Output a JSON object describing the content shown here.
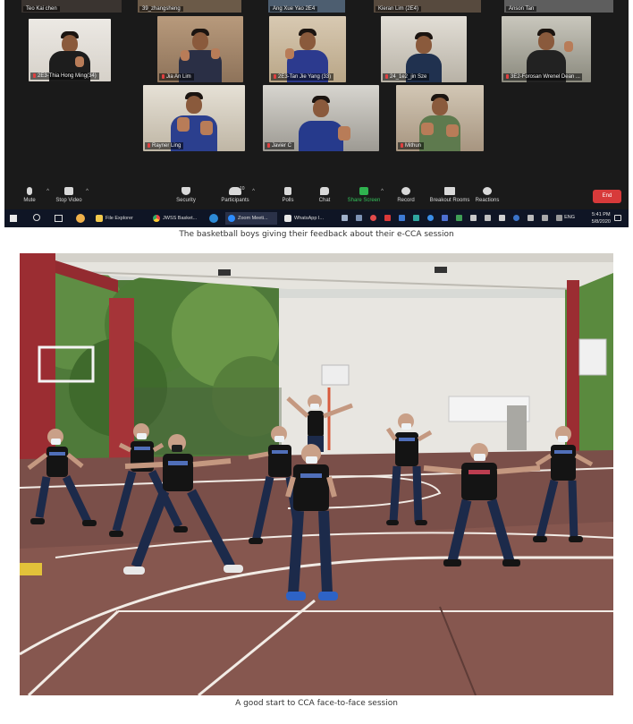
{
  "zoom": {
    "partial_names": [
      "Teo Kai chen",
      "39_zhangsheng",
      "Ang Xue Yao 2E4",
      "Kieran Lim (2E4)",
      "Anson Tan"
    ],
    "row1_names": [
      "2E3-Thia Hong Ming(34)",
      "Jia An Lim",
      "2E3-Tan Jie Yang (33)",
      "24_1e2_jin Sze",
      "3E2-Forosan Wrenel Dean ..."
    ],
    "row2_names": [
      "Rayner Ling",
      "Javier C",
      "Mithun"
    ],
    "toolbar": {
      "mute": "Mute",
      "stop_video": "Stop Video",
      "security": "Security",
      "participants": "Participants",
      "participants_count": "10",
      "polls": "Polls",
      "chat": "Chat",
      "share_screen": "Share Screen",
      "record": "Record",
      "breakout_rooms": "Breakout Rooms",
      "reactions": "Reactions",
      "end": "End"
    },
    "taskbar": {
      "apps": [
        "File Explorer",
        "JWSS Basket...",
        "Zoom Meeti...",
        "WhatsApp I..."
      ],
      "language": "ENG",
      "time": "5:41 PM",
      "date": "5/8/2020"
    },
    "colors": {
      "end_button": "#d73a3a",
      "share_green": "#2fb24f",
      "taskbar": "#0f1525"
    }
  },
  "captions": {
    "top": "The basketball boys giving their feedback about their e-CCA session",
    "bottom": "A good start to CCA face-to-face session"
  }
}
